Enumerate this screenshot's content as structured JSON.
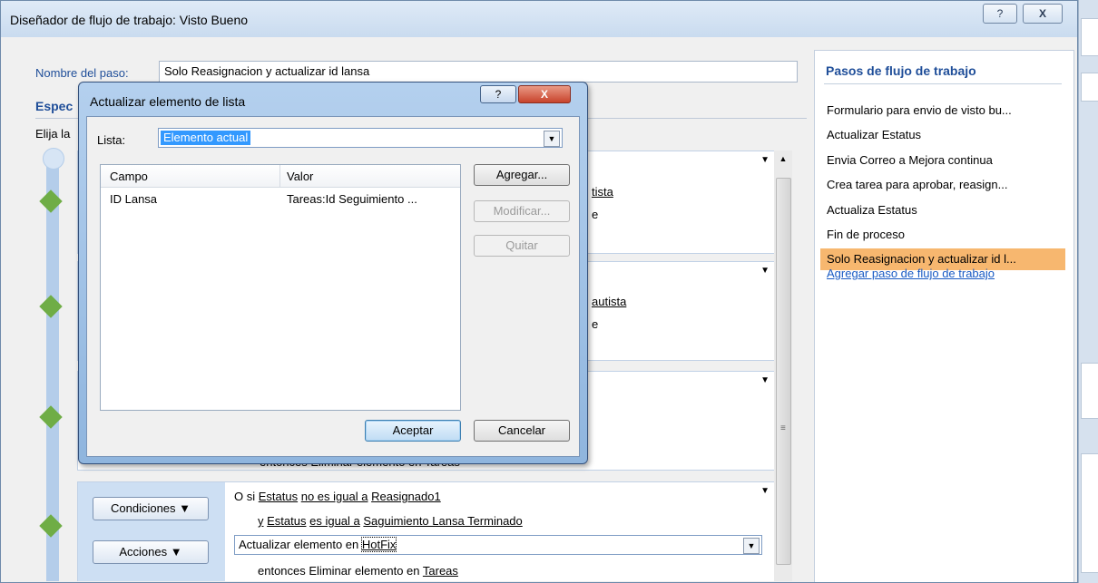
{
  "window": {
    "title": "Diseñador de flujo de trabajo: Visto Bueno",
    "help_label": "?",
    "close_label": "X"
  },
  "step": {
    "name_label": "Nombre del paso:",
    "name_value": "Solo Reasignacion y actualizar id lansa",
    "specify_heading": "Espec",
    "choose_label": "Elija la"
  },
  "branches": [
    {
      "frag1": "tista",
      "frag2": "e"
    },
    {
      "frag1": "autista",
      "frag2": "e"
    },
    {
      "frag1": "entonces Eliminar elemento en Tareas"
    }
  ],
  "last_branch": {
    "conditions_label": "Condiciones ▼",
    "actions_label": "Acciones ▼",
    "cond1_prefix": "O si",
    "cond1_field": "Estatus",
    "cond1_op": "no es igual a",
    "cond1_value": "Reasignado1",
    "cond2_prefix": "y",
    "cond2_field": "Estatus",
    "cond2_op": "es igual a",
    "cond2_value": "Saguimiento Lansa Terminado",
    "action_prefix": "Actualizar elemento en",
    "action_target": "HotFix",
    "action2_prefix": "entonces Eliminar elemento en",
    "action2_target": "Tareas"
  },
  "right_panel": {
    "title": "Pasos de flujo de trabajo",
    "steps": [
      "Formulario para envio de visto bu...",
      "Actualizar Estatus",
      "Envia Correo a Mejora continua",
      "Crea tarea para aprobar, reasign...",
      "Actualiza Estatus",
      "Fin de proceso",
      "Solo Reasignacion y actualizar id l..."
    ],
    "selected_index": 6,
    "add_step_link": "Agregar paso de flujo de trabajo"
  },
  "dialog": {
    "title": "Actualizar elemento de lista",
    "help_label": "?",
    "close_label": "X",
    "list_label": "Lista:",
    "list_value": "Elemento actual",
    "table": {
      "columns": [
        "Campo",
        "Valor"
      ],
      "rows": [
        [
          "ID Lansa",
          "Tareas:Id Seguimiento ..."
        ]
      ]
    },
    "buttons": {
      "add": "Agregar...",
      "modify": "Modificar...",
      "remove": "Quitar",
      "ok": "Aceptar",
      "cancel": "Cancelar"
    }
  }
}
